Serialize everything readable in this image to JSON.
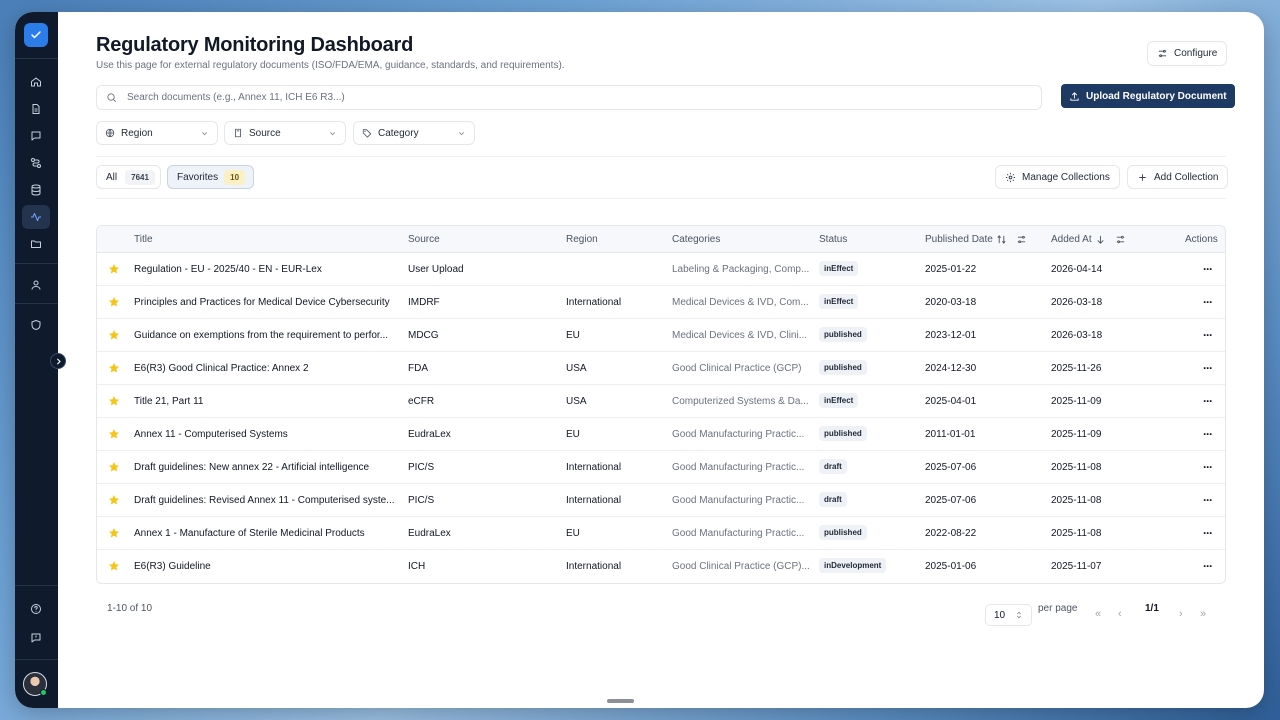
{
  "page": {
    "title": "Regulatory Monitoring Dashboard",
    "subtitle": "Use this page for external regulatory documents (ISO/FDA/EMA, guidance, standards, and requirements).",
    "configure_label": "Configure",
    "upload_label": "Upload Regulatory Document"
  },
  "search": {
    "placeholder": "Search documents (e.g., Annex 11, ICH E6 R3...)"
  },
  "filters": {
    "region": "Region",
    "source": "Source",
    "category": "Category"
  },
  "tabs": {
    "all": {
      "label": "All",
      "count": "7641"
    },
    "favorites": {
      "label": "Favorites",
      "count": "10"
    }
  },
  "collections": {
    "manage_label": "Manage Collections",
    "add_label": "Add Collection"
  },
  "table": {
    "headers": {
      "title": "Title",
      "source": "Source",
      "region": "Region",
      "categories": "Categories",
      "status": "Status",
      "published": "Published Date",
      "added": "Added At",
      "actions": "Actions"
    },
    "rows": [
      {
        "title": "Regulation - EU - 2025/40 - EN - EUR-Lex",
        "source": "User Upload",
        "region": "",
        "categories": "Labeling & Packaging, Comp...",
        "status": "inEffect",
        "published": "2025-01-22",
        "added": "2026-04-14"
      },
      {
        "title": "Principles and Practices for Medical Device Cybersecurity",
        "source": "IMDRF",
        "region": "International",
        "categories": "Medical Devices & IVD, Com...",
        "status": "inEffect",
        "published": "2020-03-18",
        "added": "2026-03-18"
      },
      {
        "title": "Guidance on exemptions from the requirement to perfor...",
        "source": "MDCG",
        "region": "EU",
        "categories": "Medical Devices & IVD, Clini...",
        "status": "published",
        "published": "2023-12-01",
        "added": "2026-03-18"
      },
      {
        "title": "E6(R3) Good Clinical Practice: Annex 2",
        "source": "FDA",
        "region": "USA",
        "categories": "Good Clinical Practice (GCP)",
        "status": "published",
        "published": "2024-12-30",
        "added": "2025-11-26"
      },
      {
        "title": "Title 21, Part 11",
        "source": "eCFR",
        "region": "USA",
        "categories": "Computerized Systems & Da...",
        "status": "inEffect",
        "published": "2025-04-01",
        "added": "2025-11-09"
      },
      {
        "title": "Annex 11 - Computerised Systems",
        "source": "EudraLex",
        "region": "EU",
        "categories": "Good Manufacturing Practic...",
        "status": "published",
        "published": "2011-01-01",
        "added": "2025-11-09"
      },
      {
        "title": "Draft guidelines: New annex 22 - Artificial intelligence",
        "source": "PIC/S",
        "region": "International",
        "categories": "Good Manufacturing Practic...",
        "status": "draft",
        "published": "2025-07-06",
        "added": "2025-11-08"
      },
      {
        "title": "Draft guidelines: Revised Annex 11 - Computerised syste...",
        "source": "PIC/S",
        "region": "International",
        "categories": "Good Manufacturing Practic...",
        "status": "draft",
        "published": "2025-07-06",
        "added": "2025-11-08"
      },
      {
        "title": "Annex 1 - Manufacture of Sterile Medicinal Products",
        "source": "EudraLex",
        "region": "EU",
        "categories": "Good Manufacturing Practic...",
        "status": "published",
        "published": "2022-08-22",
        "added": "2025-11-08"
      },
      {
        "title": "E6(R3) Guideline",
        "source": "ICH",
        "region": "International",
        "categories": "Good Clinical Practice (GCP)...",
        "status": "inDevelopment",
        "published": "2025-01-06",
        "added": "2025-11-07"
      }
    ]
  },
  "pagination": {
    "range": "1-10 of 10",
    "per_page_value": "10",
    "per_page_label": "per page",
    "page": "1/1"
  },
  "colors": {
    "rail": "#0f1b2d",
    "primary": "#1e3a63",
    "star": "#f5c518",
    "logo": "#2b7de9"
  }
}
